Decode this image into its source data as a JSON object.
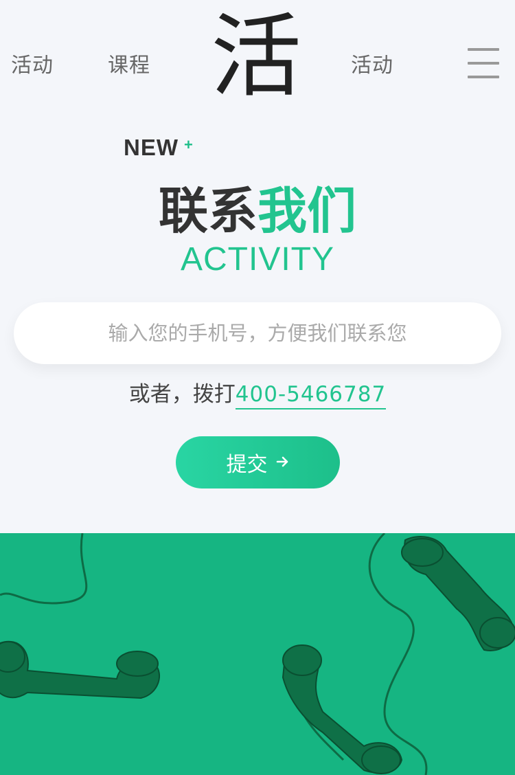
{
  "header": {
    "nav": [
      "活动",
      "课程",
      "活动"
    ],
    "logo_char": "活",
    "menu_icon": "hamburger-menu-icon"
  },
  "hero": {
    "badge": "NEW",
    "badge_sup": "+",
    "title_dark": "联系",
    "title_green": "我们",
    "subtitle": "ACTIVITY"
  },
  "form": {
    "phone_placeholder": "输入您的手机号，方便我们联系您",
    "call_prefix": "或者，拨打",
    "call_number": "400-5466787",
    "submit_label": "提交",
    "submit_icon": "arrow-right-icon"
  },
  "colors": {
    "accent": "#22c48f",
    "banner": "#16b582",
    "background": "#f4f6fa"
  }
}
